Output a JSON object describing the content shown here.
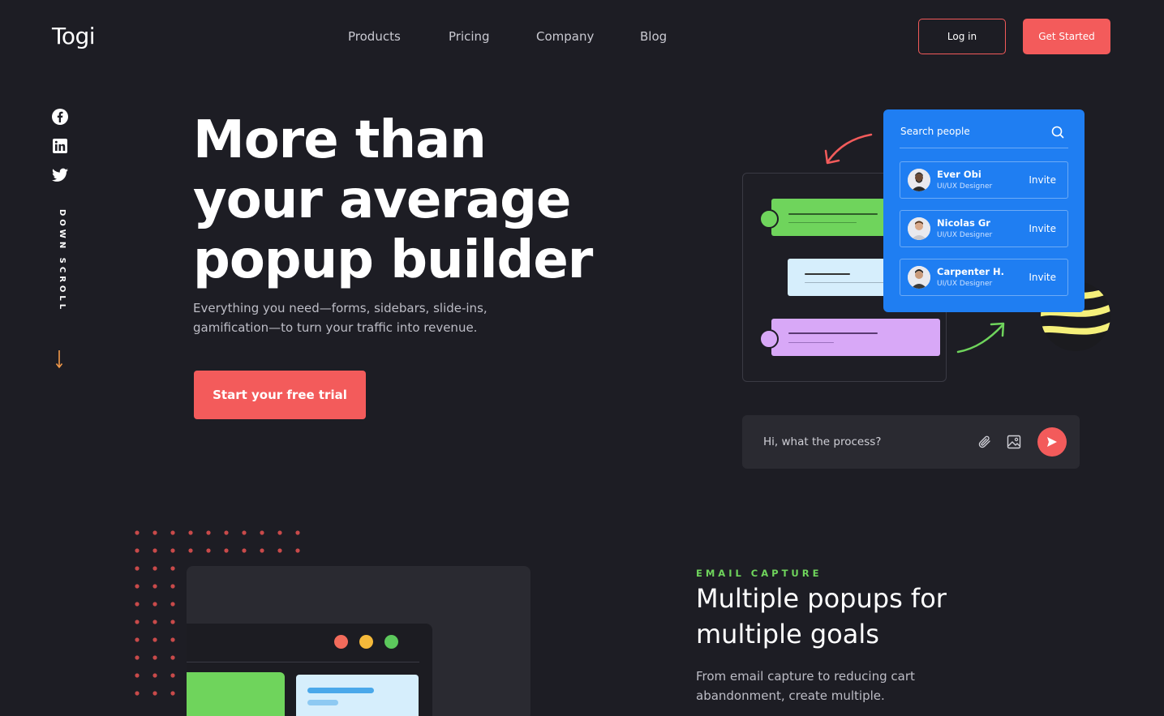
{
  "brand": {
    "logo": "Togi"
  },
  "nav": {
    "items": [
      "Products",
      "Pricing",
      "Company",
      "Blog"
    ]
  },
  "header": {
    "login_label": "Log in",
    "get_started_label": "Get Started"
  },
  "social": {
    "icons": [
      "facebook-icon",
      "linkedin-icon",
      "twitter-icon"
    ]
  },
  "scroll": {
    "label": "DOWN SCROLL"
  },
  "hero": {
    "title": "More than your average popup builder",
    "subtitle": "Everything you need—forms, sidebars, slide-ins, gamification—to turn your traffic into revenue.",
    "cta_label": "Start your free trial"
  },
  "search_panel": {
    "placeholder": "Search people",
    "people": [
      {
        "name": "Ever Obi",
        "role": "UI/UX Designer",
        "action": "Invite"
      },
      {
        "name": "Nicolas Gr",
        "role": "UI/UX Designer",
        "action": "Invite"
      },
      {
        "name": "Carpenter H.",
        "role": "UI/UX Designer",
        "action": "Invite"
      }
    ]
  },
  "chat": {
    "message": "Hi, what the process?"
  },
  "section2": {
    "eyebrow": "EMAIL CAPTURE",
    "title": "Multiple popups for multiple goals",
    "subtitle": "From email capture to reducing cart abandonment, create multiple."
  },
  "colors": {
    "background": "#1d1d24",
    "accent_red": "#f35b5b",
    "accent_green": "#6fd45c",
    "accent_blue": "#1f7ef2",
    "accent_purple": "#d8a8f7",
    "accent_yellow": "#f5f07a"
  }
}
